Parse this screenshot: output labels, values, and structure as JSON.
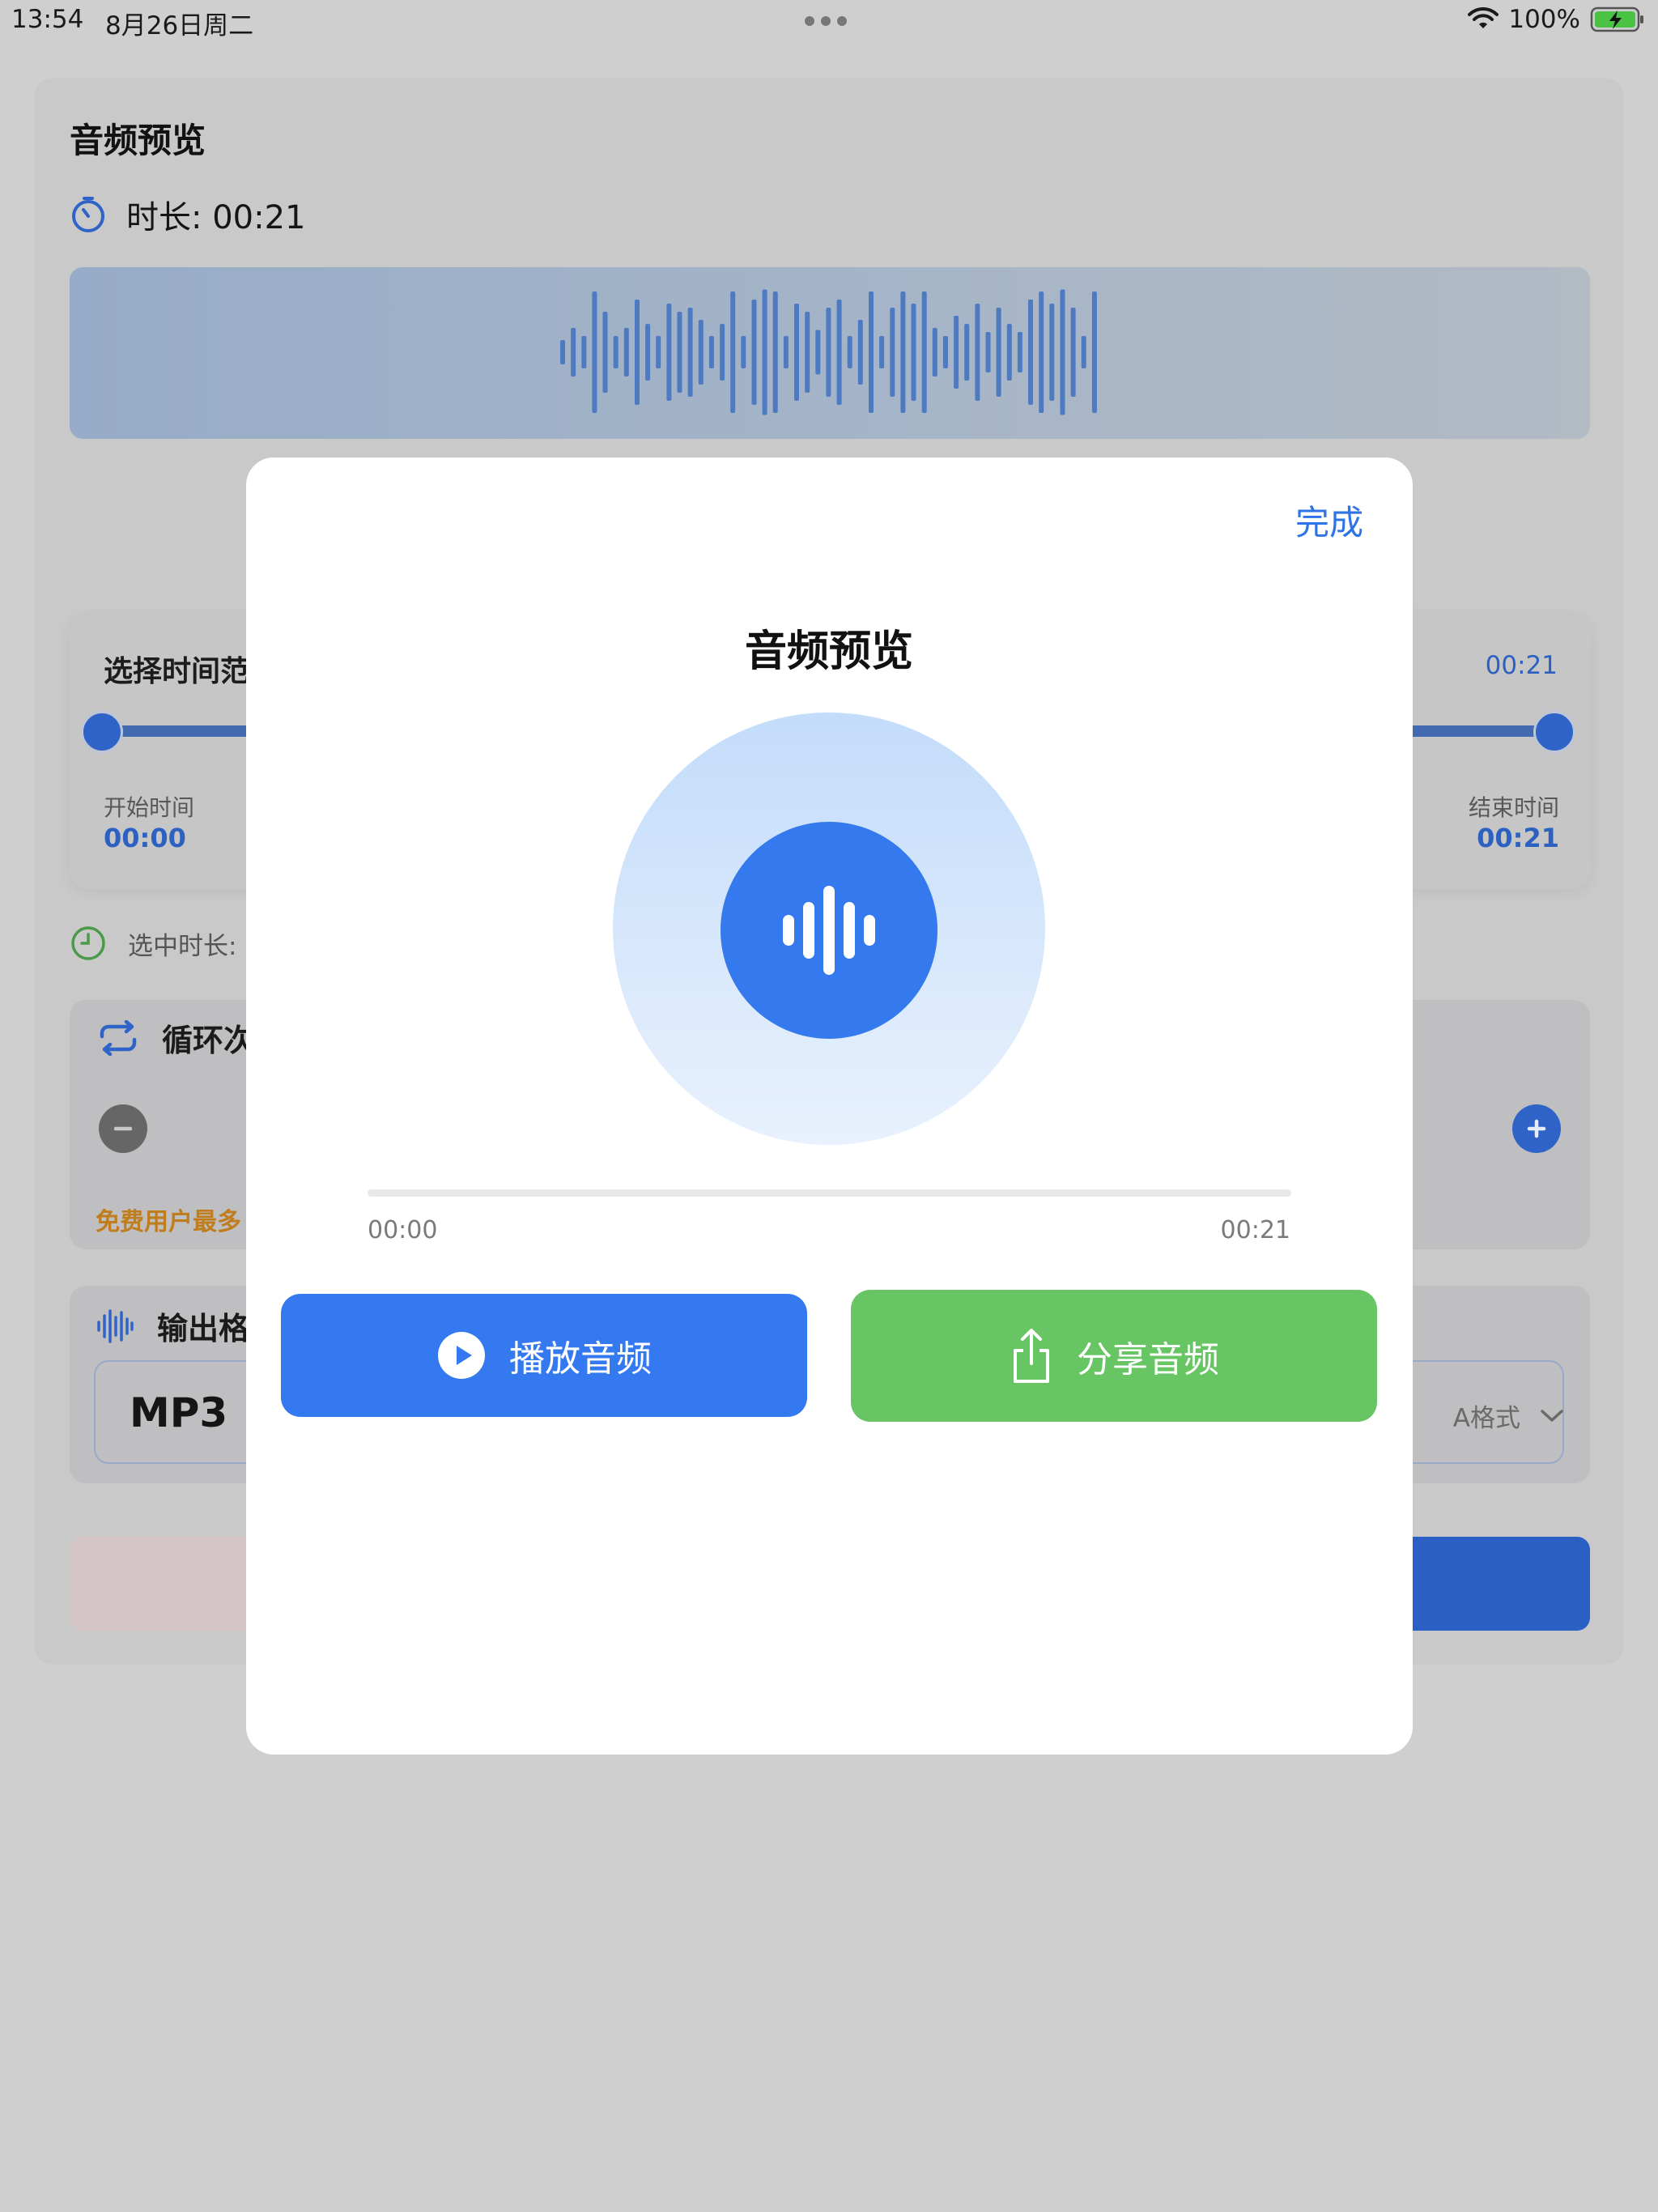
{
  "status_bar": {
    "time": "13:54",
    "date": "8月26日周二",
    "battery": "100%",
    "icons": [
      "wifi-icon",
      "battery-charging-icon"
    ]
  },
  "background": {
    "title": "音频预览",
    "duration_label": "时长: 00:21",
    "range": {
      "label": "选择时间范",
      "top_value": "00:21",
      "start_label": "开始时间",
      "start_value": "00:00",
      "end_label": "结束时间",
      "end_value": "00:21"
    },
    "selected_duration_label": "选中时长:",
    "loop": {
      "title": "循环次",
      "note": "免费用户最多"
    },
    "format": {
      "title": "输出格",
      "value": "MP3",
      "right_text": "A格式"
    }
  },
  "modal": {
    "done_label": "完成",
    "title": "音频预览",
    "progress": {
      "current": "00:00",
      "total": "00:21",
      "fraction": 0
    },
    "play_label": "播放音频",
    "share_label": "分享音频"
  },
  "colors": {
    "accent_blue": "#3479f0",
    "share_green": "#67c563",
    "link_blue": "#2d74e8"
  }
}
